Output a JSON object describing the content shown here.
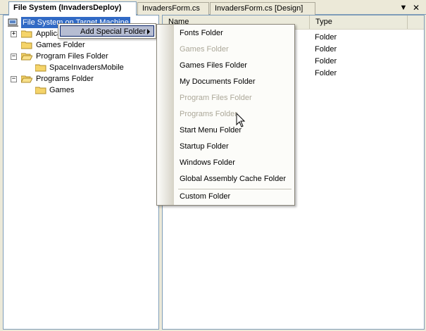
{
  "tabs": [
    {
      "label": "File System (InvadersDeploy)",
      "active": true
    },
    {
      "label": "InvadersForm.cs",
      "active": false
    },
    {
      "label": "InvadersForm.cs [Design]",
      "active": false
    }
  ],
  "tab_controls": {
    "dropdown": "▼",
    "close": "✕"
  },
  "tree": {
    "root": "File System on Target Machine",
    "nodes": [
      {
        "label": "Application Folder",
        "visible_label": "Applica",
        "expander": "+"
      },
      {
        "label": "Games Folder",
        "expander": ""
      },
      {
        "label": "Program Files Folder",
        "expander": "−"
      },
      {
        "label": "SpaceInvadersMobile",
        "expander": ""
      },
      {
        "label": "Programs Folder",
        "expander": "−"
      },
      {
        "label": "Games",
        "expander": ""
      }
    ]
  },
  "list": {
    "columns": {
      "name": "Name",
      "type": "Type"
    },
    "types": [
      "Folder",
      "Folder",
      "Folder",
      "Folder"
    ]
  },
  "context_menu": {
    "parent_item": "Add Special Folder",
    "items": [
      {
        "label": "Fonts Folder",
        "enabled": true
      },
      {
        "label": "Games Folder",
        "enabled": false
      },
      {
        "label": "Games Files Folder",
        "enabled": true
      },
      {
        "label": "My Documents Folder",
        "enabled": true
      },
      {
        "label": "Program Files Folder",
        "enabled": false
      },
      {
        "label": "Programs Folder",
        "enabled": false
      },
      {
        "label": "Start Menu Folder",
        "enabled": true
      },
      {
        "label": "Startup Folder",
        "enabled": true
      },
      {
        "label": "Windows Folder",
        "enabled": true
      },
      {
        "label": "Global Assembly Cache Folder",
        "enabled": true
      },
      {
        "label": "Custom Folder",
        "enabled": true
      }
    ]
  },
  "colors": {
    "selection": "#316ac5",
    "menu_highlight": "#b6bdd2",
    "disabled_text": "#aca899",
    "folder": "#f5d46a"
  }
}
